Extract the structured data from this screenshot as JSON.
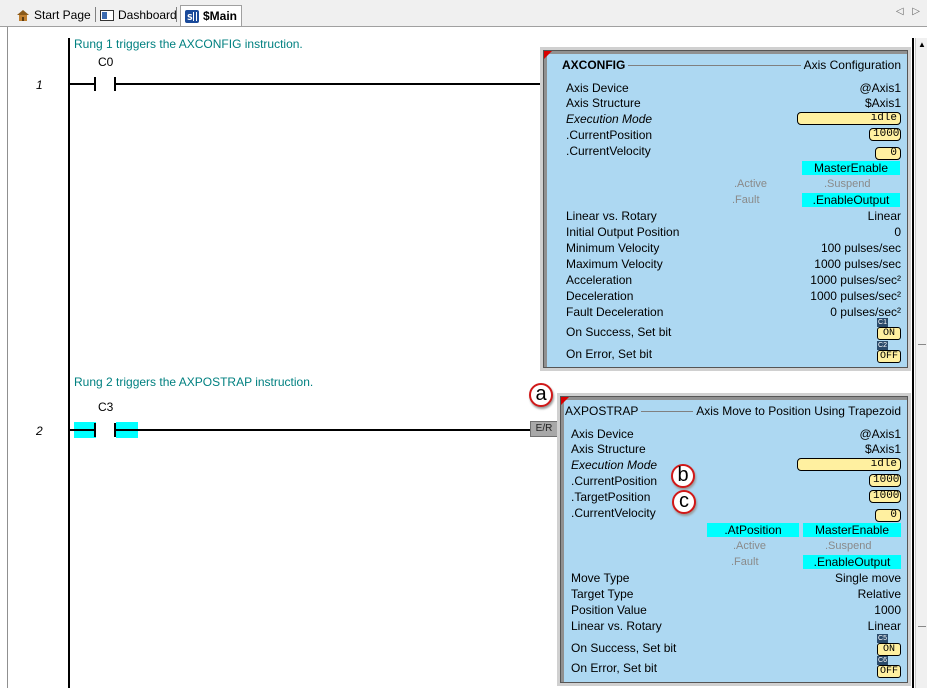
{
  "tabs": {
    "start_page": "Start Page",
    "dashboard": "Dashboard",
    "main": "$Main",
    "scroll_arrows": "◁ ▷"
  },
  "rung1": {
    "number": "1",
    "comment": "Rung 1 triggers the AXCONFIG instruction.",
    "contact": "C0",
    "box": {
      "name": "AXCONFIG",
      "title": "Axis Configuration",
      "axis_device_label": "Axis Device",
      "axis_device": "@Axis1",
      "axis_structure_label": "Axis Structure",
      "axis_structure": "$Axis1",
      "exec_mode_label": "Execution Mode",
      "exec_mode": "idle",
      "cur_pos_label": ".CurrentPosition",
      "cur_pos": "1000",
      "cur_vel_label": ".CurrentVelocity",
      "cur_vel": "0",
      "master_enable": "MasterEnable",
      "active": ".Active",
      "suspend": ".Suspend",
      "fault": ".Fault",
      "enable_output": ".EnableOutput",
      "params": [
        {
          "label": "Linear vs. Rotary",
          "value": "Linear"
        },
        {
          "label": "Initial Output Position",
          "value": "0"
        },
        {
          "label": "Minimum Velocity",
          "value": "100 pulses/sec"
        },
        {
          "label": "Maximum Velocity",
          "value": "1000 pulses/sec"
        },
        {
          "label": "Acceleration",
          "value": "1000 pulses/sec²"
        },
        {
          "label": "Deceleration",
          "value": "1000 pulses/sec²"
        },
        {
          "label": "Fault Deceleration",
          "value": "0 pulses/sec²"
        }
      ],
      "on_success_label": "On Success, Set bit",
      "on_success_tag": "C1",
      "on_success_val": "ON",
      "on_error_label": "On Error, Set bit",
      "on_error_tag": "C2",
      "on_error_val": "OFF"
    }
  },
  "rung2": {
    "number": "2",
    "comment": "Rung 2 triggers the AXPOSTRAP instruction.",
    "contact": "C3",
    "er": "E/R",
    "box": {
      "name": "AXPOSTRAP",
      "title": "Axis Move to Position Using Trapezoid",
      "axis_device_label": "Axis Device",
      "axis_device": "@Axis1",
      "axis_structure_label": "Axis Structure",
      "axis_structure": "$Axis1",
      "exec_mode_label": "Execution Mode",
      "exec_mode": "idle",
      "cur_pos_label": ".CurrentPosition",
      "cur_pos": "1000",
      "target_pos_label": ".TargetPosition",
      "target_pos": "1000",
      "cur_vel_label": ".CurrentVelocity",
      "cur_vel": "0",
      "at_position": ".AtPosition",
      "master_enable": "MasterEnable",
      "active": ".Active",
      "suspend": ".Suspend",
      "fault": ".Fault",
      "enable_output": ".EnableOutput",
      "params": [
        {
          "label": "Move Type",
          "value": "Single move"
        },
        {
          "label": "Target Type",
          "value": "Relative"
        },
        {
          "label": "Position Value",
          "value": "1000"
        },
        {
          "label": "Linear vs. Rotary",
          "value": "Linear"
        }
      ],
      "on_success_label": "On Success, Set bit",
      "on_success_tag": "C5",
      "on_success_val": "ON",
      "on_error_label": "On Error, Set bit",
      "on_error_tag": "C6",
      "on_error_val": "OFF"
    }
  },
  "callouts": {
    "a": "a",
    "b": "b",
    "c": "c"
  },
  "colors": {
    "box_fill": "#add8f2",
    "highlight": "#00ffff",
    "field": "#fff0a0",
    "comment": "#008080",
    "callout": "#d01818"
  }
}
